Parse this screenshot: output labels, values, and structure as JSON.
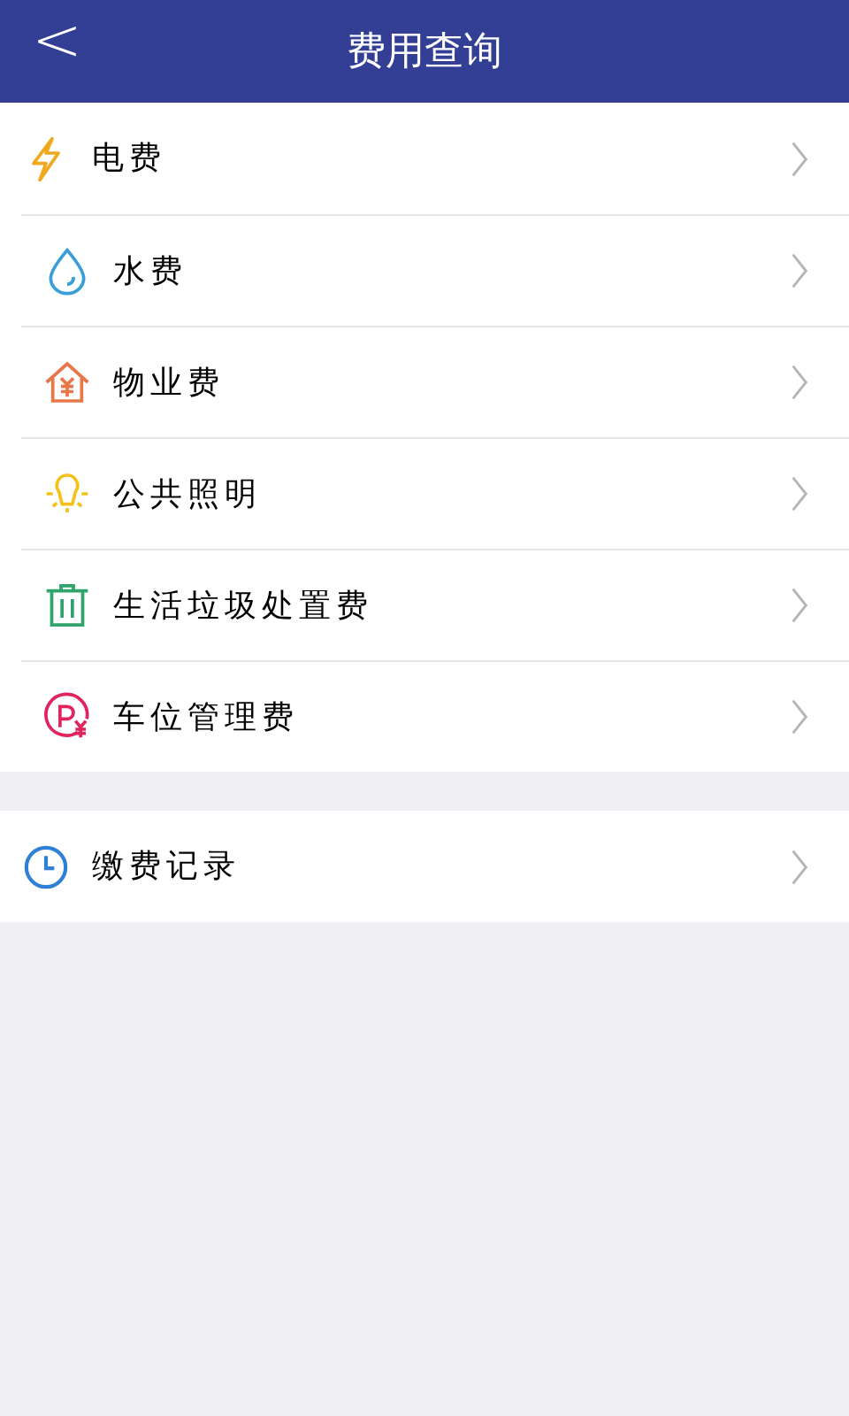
{
  "header": {
    "back": "<",
    "title": "费用查询"
  },
  "groups": [
    {
      "items": [
        {
          "label": "电费"
        },
        {
          "label": "水费"
        },
        {
          "label": "物业费"
        },
        {
          "label": "公共照明"
        },
        {
          "label": "生活垃圾处置费"
        },
        {
          "label": "车位管理费"
        }
      ]
    },
    {
      "items": [
        {
          "label": "缴费记录"
        }
      ]
    }
  ]
}
